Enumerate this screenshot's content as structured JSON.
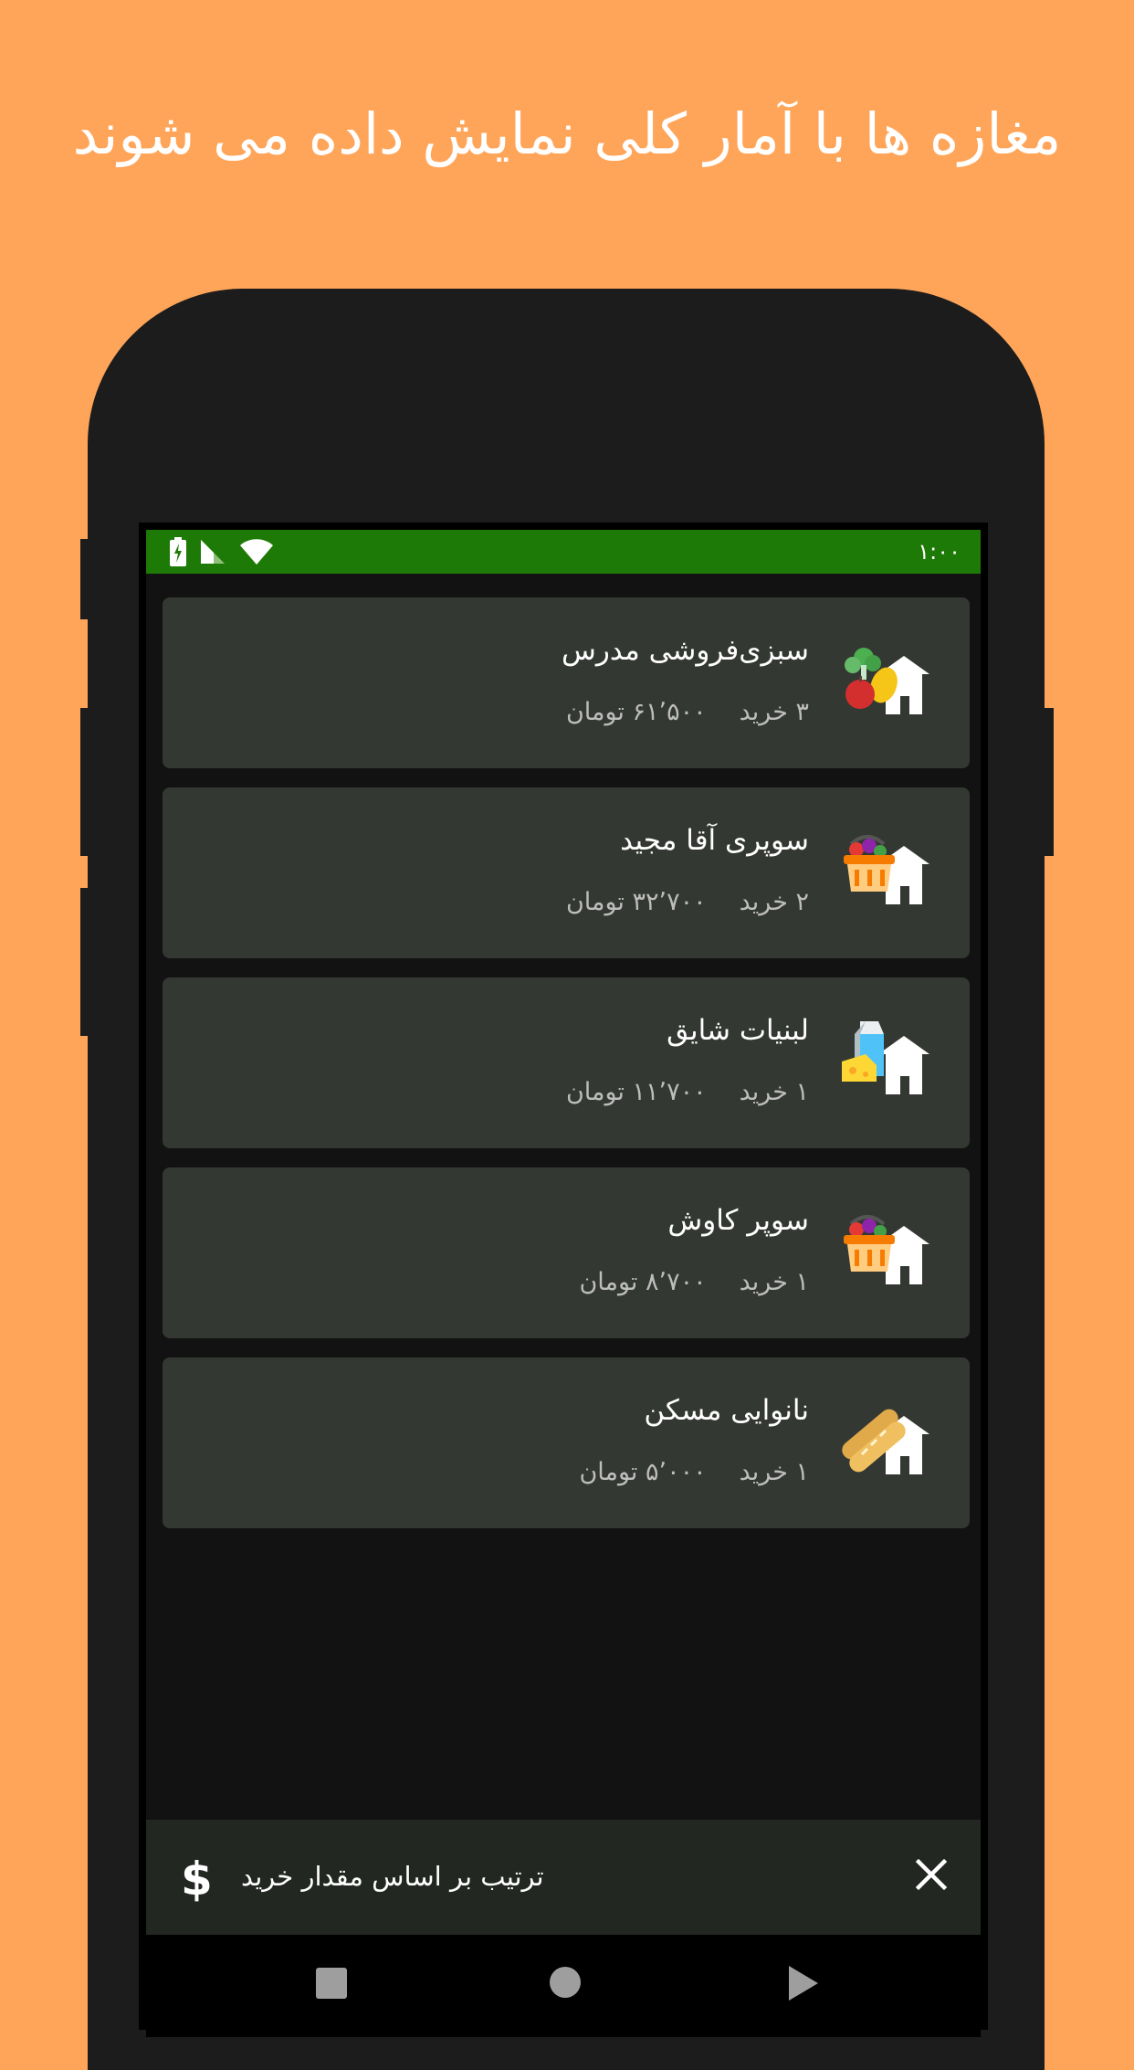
{
  "headline": "مغازه ها با آمار کلی نمایش داده می شوند",
  "status_bar": {
    "time": "۱:۰۰",
    "icons": [
      "battery-charging-icon",
      "cell-signal-icon",
      "wifi-icon"
    ],
    "color": "#1E7A06"
  },
  "shops": [
    {
      "name": "سبزی‌فروشی مدرس",
      "purchases": "۳ خرید",
      "total": "۶۱٬۵۰۰ تومان",
      "icon": "vegetables-shop-icon"
    },
    {
      "name": "سوپری آقا مجید",
      "purchases": "۲ خرید",
      "total": "۳۲٬۷۰۰ تومان",
      "icon": "grocery-basket-shop-icon"
    },
    {
      "name": "لبنیات شایق",
      "purchases": "۱ خرید",
      "total": "۱۱٬۷۰۰ تومان",
      "icon": "dairy-shop-icon"
    },
    {
      "name": "سوپر کاوش",
      "purchases": "۱ خرید",
      "total": "۸٬۷۰۰ تومان",
      "icon": "grocery-basket-shop-icon"
    },
    {
      "name": "نانوایی مسکن",
      "purchases": "۱ خرید",
      "total": "۵٬۰۰۰ تومان",
      "icon": "bakery-shop-icon"
    }
  ],
  "sort_bar": {
    "label": "ترتیب بر اساس مقدار خرید",
    "symbol": "$",
    "close_icon": "close-icon"
  },
  "nav_bar": {
    "icons": [
      "recents-square-icon",
      "home-circle-icon",
      "back-triangle-icon"
    ]
  },
  "colors": {
    "background": "#FFA55A",
    "card": "#343832",
    "screen": "#121212"
  }
}
